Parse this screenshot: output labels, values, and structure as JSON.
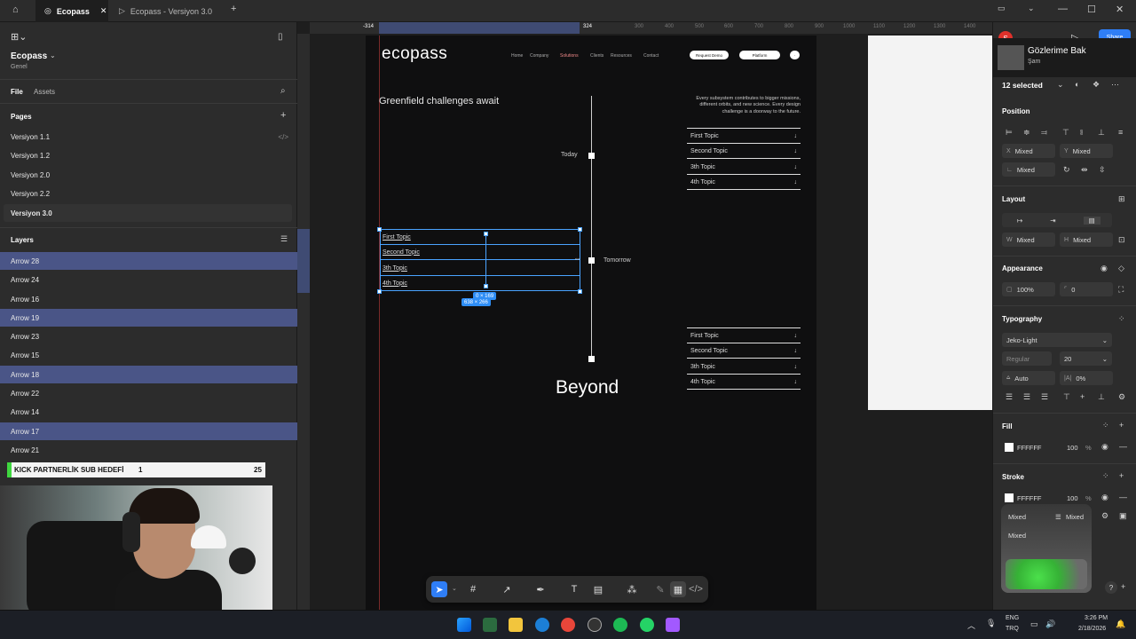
{
  "tabs": [
    {
      "label": "Ecopass"
    },
    {
      "label": "Ecopass - Versiyon 3.0"
    }
  ],
  "left": {
    "project": "Ecopass",
    "team": "Genel",
    "file_tab": "File",
    "assets_tab": "Assets",
    "pages_title": "Pages",
    "pages": [
      {
        "label": "Versiyon 1.1"
      },
      {
        "label": "Versiyon 1.2"
      },
      {
        "label": "Versiyon 2.0"
      },
      {
        "label": "Versiyon 2.2"
      },
      {
        "label": "Versiyon 3.0"
      }
    ],
    "layers_title": "Layers",
    "layers": [
      {
        "label": "Arrow 28"
      },
      {
        "label": "Arrow 24"
      },
      {
        "label": "Arrow 16"
      },
      {
        "label": "Arrow 19"
      },
      {
        "label": "Arrow 23"
      },
      {
        "label": "Arrow 15"
      },
      {
        "label": "Arrow 18"
      },
      {
        "label": "Arrow 22"
      },
      {
        "label": "Arrow 14"
      },
      {
        "label": "Arrow 17"
      },
      {
        "label": "Arrow 21"
      }
    ]
  },
  "overlay": {
    "kick_label": "KICK PARTNERLİK SUB HEDEFİ",
    "kick_current": "1",
    "kick_goal": "25",
    "mini_title": "Gözlerime Bak",
    "mini_sub": "Şam"
  },
  "ruler": {
    "marks": [
      "-314",
      "324",
      "300",
      "400",
      "500",
      "600",
      "700",
      "800",
      "900",
      "1000",
      "1100",
      "1200",
      "1300",
      "1400",
      "1500",
      "1600"
    ]
  },
  "design": {
    "logo": "ecopass",
    "nav": [
      "Home",
      "Company",
      "Solutions",
      "Clients",
      "Resources",
      "Contact"
    ],
    "btn_request": "Request Demo",
    "btn_platform": "Platform",
    "heading": "Greenfield challenges await",
    "blurb": "Every subsystem contributes to bigger missions, different orbits, and new science. Every design challenge is a doorway to the future.",
    "today": "Today",
    "tomorrow": "Tomorrow",
    "beyond": "Beyond",
    "topics": [
      "First Topic",
      "Second Topic",
      "3th Topic",
      "4th Topic"
    ],
    "size_badge": "0 × 169",
    "size_badge2": "638 × 266"
  },
  "right": {
    "selected": "12 selected",
    "position": "Position",
    "x_lbl": "X",
    "x_val": "Mixed",
    "y_lbl": "Y",
    "y_val": "Mixed",
    "rot_val": "Mixed",
    "layout": "Layout",
    "w_lbl": "W",
    "w_val": "Mixed",
    "h_lbl": "H",
    "h_val": "Mixed",
    "appearance": "Appearance",
    "opacity": "100%",
    "radius": "0",
    "typography": "Typography",
    "font": "Jeko-Light",
    "weight": "Regular",
    "size": "20",
    "line": "Auto",
    "letter": "0%",
    "fill": "Fill",
    "fill_hex": "FFFFFF",
    "fill_op": "100",
    "pct": "%",
    "stroke": "Stroke",
    "stroke_hex": "FFFFFF",
    "stroke_op": "100",
    "stroke_mixed": "Mixed",
    "stroke_mixed2": "Mixed",
    "stroke_mixed3": "Mixed",
    "share": "Share",
    "avatar": "S"
  },
  "taskbar": {
    "lang": "ENG",
    "lang2": "TRQ",
    "time": "3:26 PM",
    "date": "2/18/2026"
  },
  "colors": {
    "accent": "#4a5587",
    "selection": "#4aa3ff",
    "share": "#2f7ef6"
  }
}
